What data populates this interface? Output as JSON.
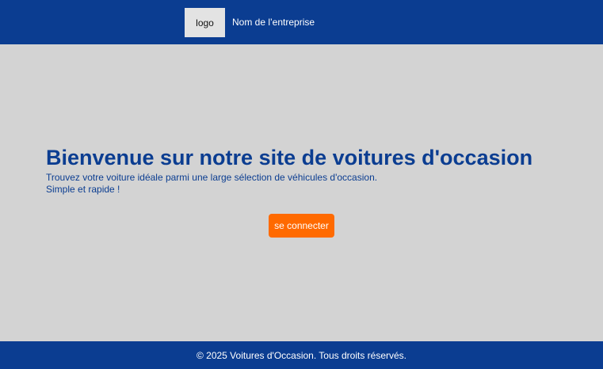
{
  "header": {
    "logo_label": "logo",
    "company_name": "Nom de l’entreprise"
  },
  "hero": {
    "title": "Bienvenue sur notre site de voitures d'occasion",
    "text_line1": "Trouvez votre voiture idéale parmi une large sélection de véhicules d'occasion.",
    "text_line2": "Simple et rapide !",
    "login_label": "se connecter"
  },
  "footer": {
    "copyright": "© 2025 Voitures d'Occasion. Tous droits réservés."
  },
  "colors": {
    "primary": "#0b3d91",
    "accent": "#ff6a00",
    "background": "#d3d3d3"
  }
}
